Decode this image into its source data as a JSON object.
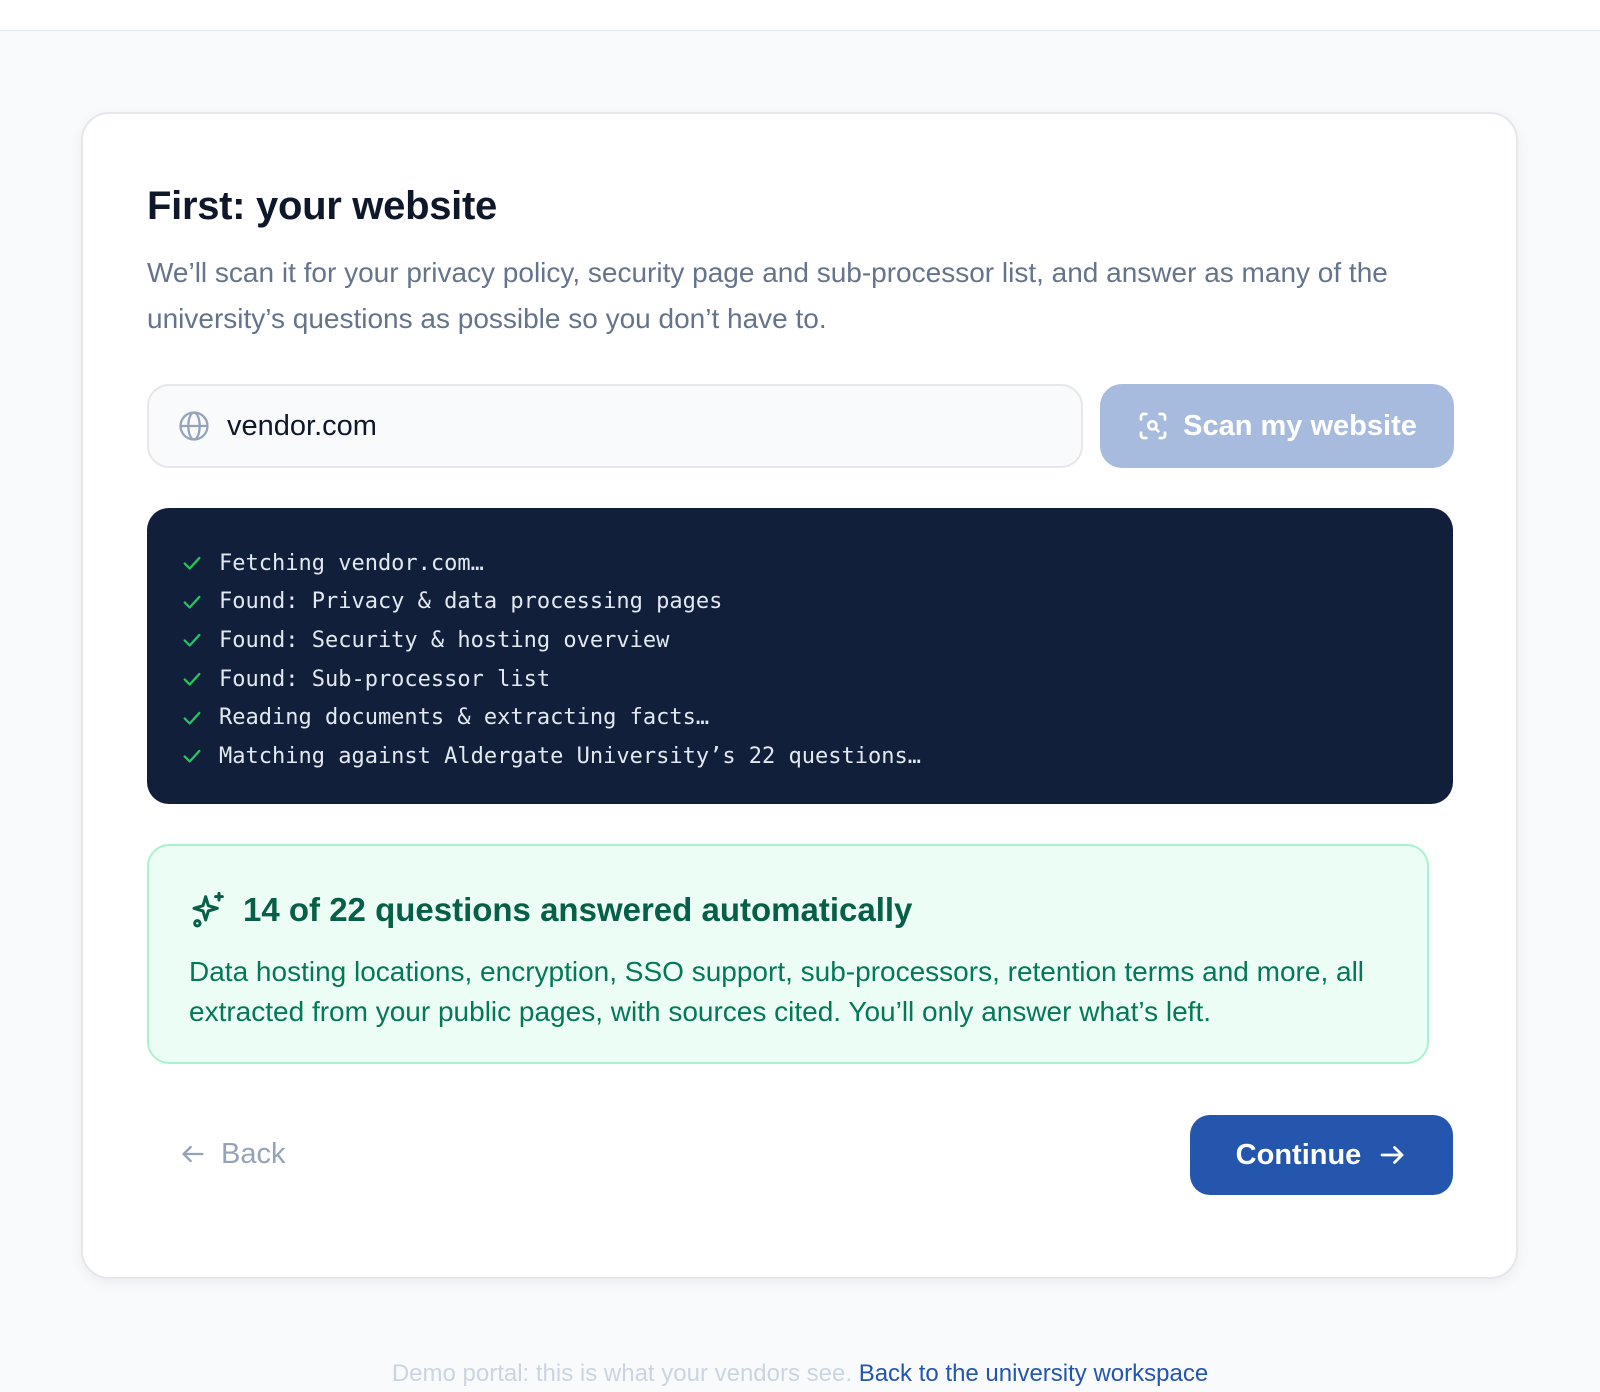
{
  "page": {
    "title": "First: your website",
    "subtitle": "We’ll scan it for your privacy policy, security page and sub-processor list, and answer as many of the university’s questions as possible so you don’t have to."
  },
  "website_field": {
    "value": "vendor.com",
    "icon": "globe-icon"
  },
  "scan_button": {
    "label": "Scan my website",
    "icon": "scan-icon",
    "disabled": true
  },
  "scan_log": {
    "lines": [
      "Fetching vendor.com…",
      "Found: Privacy & data processing pages",
      "Found: Security & hosting overview",
      "Found: Sub-processor list",
      "Reading documents & extracting facts…",
      "Matching against Aldergate University’s 22 questions…"
    ],
    "status_icon": "check-icon"
  },
  "result": {
    "icon": "sparkles-icon",
    "title": "14 of 22 questions answered automatically",
    "answered": 14,
    "total": 22,
    "body": "Data hosting locations, encryption, SSO support, sub-processors, retention terms and more, all extracted from your public pages, with sources cited. You’ll only answer what’s left."
  },
  "nav": {
    "back_label": "Back",
    "continue_label": "Continue"
  },
  "footer": {
    "text": "Demo portal: this is what your vendors see.",
    "link_label": "Back to the university workspace"
  },
  "colors": {
    "primary": "#2556ad",
    "primary_disabled": "#a7bbdf",
    "console_bg": "#111f3b",
    "success": "#22c55e",
    "success_bg": "#ecfdf5",
    "success_text": "#065f46"
  }
}
